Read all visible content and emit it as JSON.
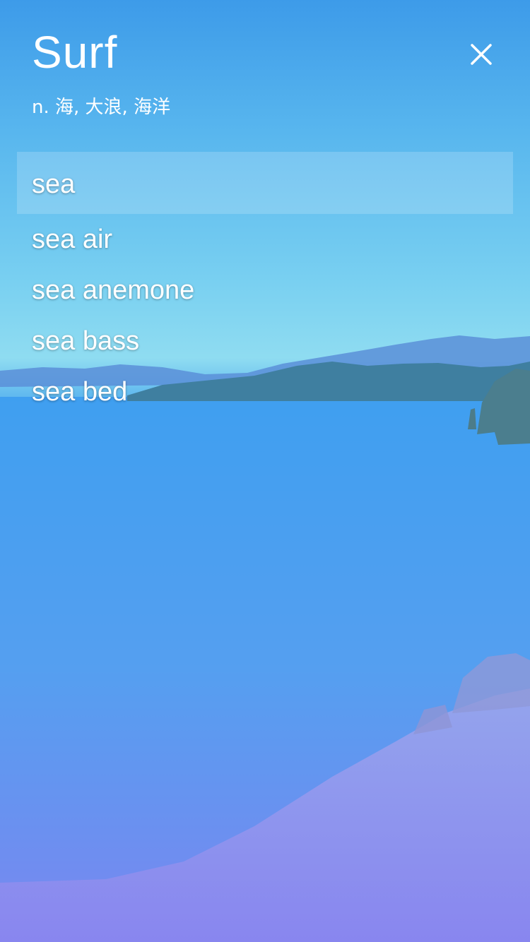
{
  "header": {
    "title": "Surf",
    "definition": "n. 海, 大浪, 海洋",
    "close_icon": "close-icon"
  },
  "suggestions": [
    {
      "label": "sea",
      "highlighted": true
    },
    {
      "label": "sea air",
      "highlighted": false
    },
    {
      "label": "sea anemone",
      "highlighted": false
    },
    {
      "label": "sea bass",
      "highlighted": false
    },
    {
      "label": "sea bed",
      "highlighted": false
    }
  ],
  "colors": {
    "text": "#ffffff",
    "top": "#3d9be9",
    "bottom": "#7d7ff0",
    "highlight": "rgba(255,255,255,0.18)"
  }
}
